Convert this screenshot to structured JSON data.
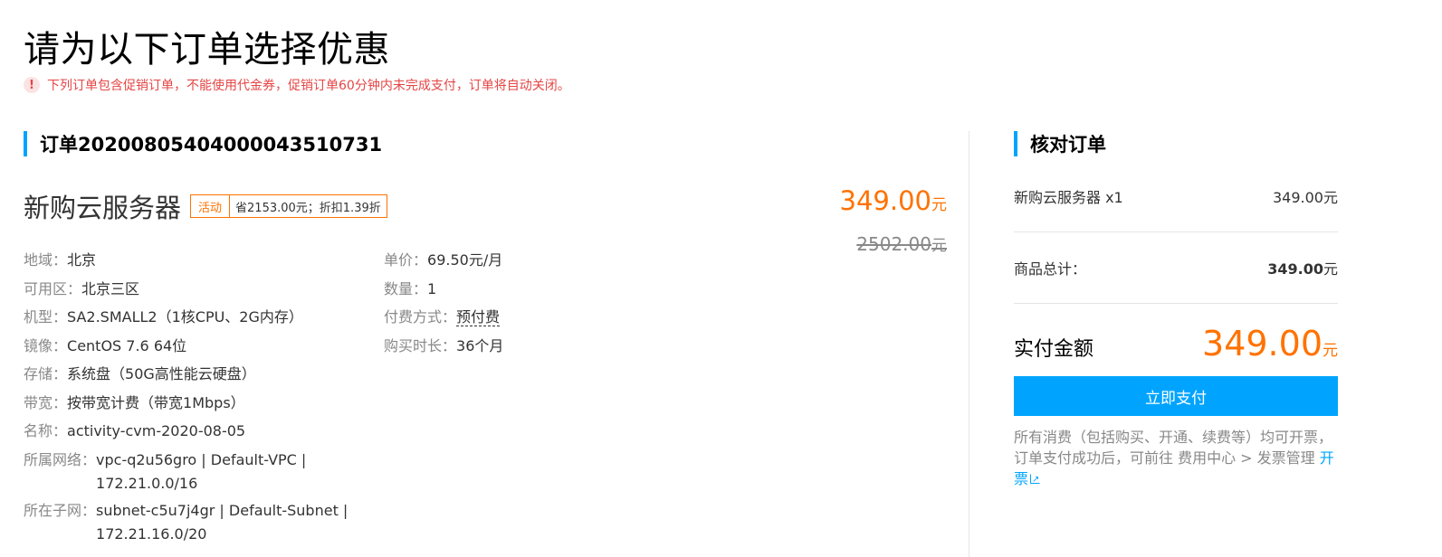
{
  "page": {
    "title": "请为以下订单选择优惠",
    "notice_icon": "!",
    "notice": "下列订单包含促销订单，不能使用代金券，促销订单60分钟内未完成支付，订单将自动关闭。"
  },
  "order": {
    "heading": "订单20200805404000043510731",
    "product_name": "新购云服务器",
    "promo_tag": "活动",
    "promo_text": "省2153.00元；折扣1.39折",
    "price": "349.00",
    "price_unit": "元",
    "orig_price": "2502.00",
    "orig_unit": "元",
    "left_details": [
      {
        "label": "地域：",
        "value": "北京"
      },
      {
        "label": "可用区：",
        "value": "北京三区"
      },
      {
        "label": "机型：",
        "value": "SA2.SMALL2（1核CPU、2G内存）"
      },
      {
        "label": "镜像：",
        "value": "CentOS 7.6 64位"
      },
      {
        "label": "存储：",
        "value": "系统盘（50G高性能云硬盘）"
      },
      {
        "label": "带宽：",
        "value": "按带宽计费（带宽1Mbps）"
      },
      {
        "label": "名称：",
        "value": "activity-cvm-2020-08-05"
      },
      {
        "label": "所属网络：",
        "value_line1": "vpc-q2u56gro | Default-VPC |",
        "value_line2": "172.21.0.0/16"
      },
      {
        "label": "所在子网：",
        "value_line1": "subnet-c5u7j4gr | Default-Subnet |",
        "value_line2": "172.21.16.0/20"
      }
    ],
    "right_details": [
      {
        "label": "单价：",
        "value": "69.50元/月"
      },
      {
        "label": "数量：",
        "value": "1"
      },
      {
        "label": "付费方式：",
        "value": "预付费"
      },
      {
        "label": "购买时长：",
        "value": "36个月"
      }
    ]
  },
  "summary": {
    "heading": "核对订单",
    "item_name": "新购云服务器 x1",
    "item_price": "349.00元",
    "subtotal_label": "商品总计：",
    "subtotal_value": "349.00",
    "subtotal_unit": "元",
    "pay_label": "实付金额",
    "pay_amount": "349.00",
    "pay_unit": "元",
    "pay_button": "立即支付",
    "note_text": "所有消费（包括购买、开通、续费等）均可开票，订单支付成功后，可前往 费用中心 > 发票管理 ",
    "note_link": "开票"
  },
  "colors": {
    "accent_blue": "#00a4ff",
    "price_orange": "#ff7200",
    "notice_red": "#e54545"
  },
  "icons": {
    "notice": "exclamation-icon",
    "external_link": "external-link-icon"
  }
}
